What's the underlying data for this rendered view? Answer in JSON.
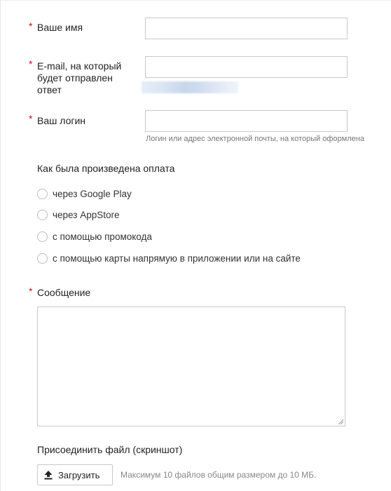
{
  "form": {
    "name": {
      "required_mark": "*",
      "label": "Ваше имя",
      "value": ""
    },
    "email": {
      "required_mark": "*",
      "label_lines": [
        "E-mail, на который",
        "будет отправлен",
        "ответ"
      ],
      "value": ""
    },
    "login": {
      "required_mark": "*",
      "label": "Ваш логин",
      "value": "",
      "hint": "Логин или адрес электронной почты, на который оформлена"
    },
    "payment": {
      "title": "Как была произведена оплата",
      "options": [
        {
          "label": "через Google Play",
          "selected": false
        },
        {
          "label": "через AppStore",
          "selected": false
        },
        {
          "label": "с помощью промокода",
          "selected": false
        },
        {
          "label": "с помощью карты напрямую в приложении или на сайте",
          "selected": false
        }
      ]
    },
    "message": {
      "required_mark": "*",
      "label": "Сообщение",
      "value": ""
    },
    "attachment": {
      "title": "Присоединить файл (скриншот)",
      "upload_label": "Загрузить",
      "upload_icon": "upload-arrow-icon",
      "note": "Максимум 10 файлов общим размером до 10 МБ."
    }
  },
  "colors": {
    "required": "#cc1111",
    "border": "#c9c9c9",
    "hint_text": "#777777"
  }
}
